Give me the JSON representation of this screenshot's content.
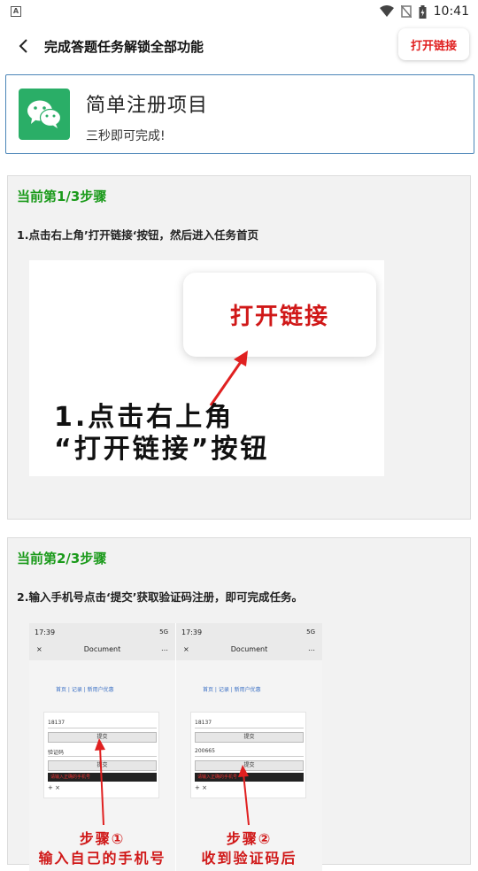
{
  "statusbar": {
    "app_badge": "A",
    "time": "10:41"
  },
  "navbar": {
    "back_glyph": "<",
    "title": "完成答题任务解锁全部功能",
    "open_link_label": "打开链接"
  },
  "project": {
    "name": "简单注册项目",
    "subtitle": "三秒即可完成!"
  },
  "steps": [
    {
      "heading": "当前第1/3步骤",
      "text": "1.点击右上角’打开链接‘按钮，然后进入任务首页",
      "image": {
        "pill_text": "打开链接",
        "caption_line1": "1.点击右上角",
        "caption_line2": "“打开链接”按钮"
      }
    },
    {
      "heading": "当前第2/3步骤",
      "text": "2.输入手机号点击‘提交’获取验证码注册，即可完成任务。",
      "image": {
        "phones": [
          {
            "time": "17:39",
            "signal": "5G",
            "title": "Document",
            "close": "×",
            "more": "…",
            "links": "首页 | 记录 | 新用户优惠",
            "phone_field": "18137",
            "submit_label": "提交",
            "code_field": "验证码",
            "submit2_label": "提交",
            "dark_text": "请输入正确的手机号",
            "plusminus": "+ ×",
            "step_label": "步骤①",
            "step_sub": "输入自己的手机号"
          },
          {
            "time": "17:39",
            "signal": "5G",
            "title": "Document",
            "close": "×",
            "more": "…",
            "links": "首页 | 记录 | 新用户优惠",
            "phone_field": "18137",
            "submit_label": "提交",
            "code_field": "200665",
            "submit2_label": "提交",
            "dark_text": "请输入正确的手机号",
            "plusminus": "+ ×",
            "step_label": "步骤②",
            "step_sub": "收到验证码后"
          }
        ]
      }
    }
  ],
  "colors": {
    "accent_red": "#e02020",
    "step_green": "#1a9a1a",
    "wechat_green": "#2aae67",
    "card_border": "#4c86b8"
  },
  "icons": {
    "wifi": "wifi-icon",
    "no_sim": "no-sim-icon",
    "battery": "battery-icon",
    "wechat": "wechat-icon",
    "back": "back-arrow-icon"
  }
}
